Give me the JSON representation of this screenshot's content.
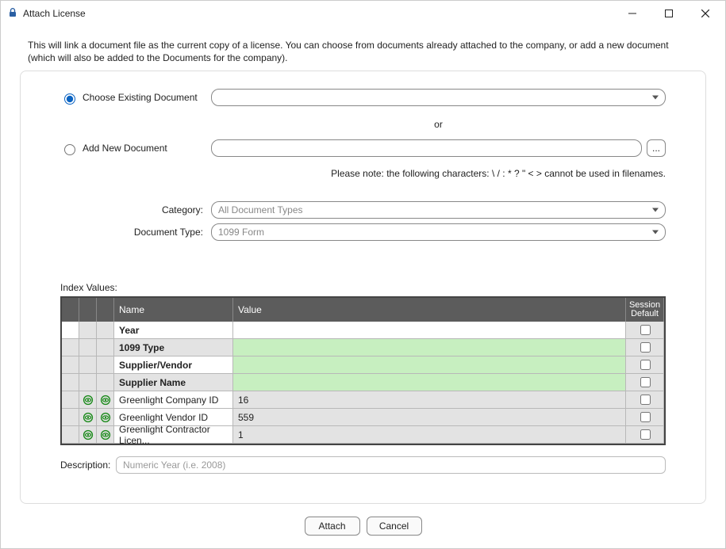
{
  "window": {
    "title": "Attach License"
  },
  "intro": "This will link a document file as the current copy of a license.  You can choose from documents already attached to the company, or add a new document (which will also be added to the Documents for the  company).",
  "radios": {
    "existing": "Choose Existing Document",
    "addnew": "Add New Document"
  },
  "or": "or",
  "ellipsis": "...",
  "note": "Please note:  the following characters:  \\ / : * ? \" < > cannot be used in filenames.",
  "form": {
    "category_label": "Category:",
    "category_value": "All Document Types",
    "doctype_label": "Document Type:",
    "doctype_value": "1099 Form"
  },
  "index_section": "Index Values:",
  "grid": {
    "head": {
      "name": "Name",
      "value": "Value",
      "session": "Session Default"
    },
    "rows": [
      {
        "bold": true,
        "a_white": true,
        "name": "Year",
        "value": "",
        "val_bg": "white"
      },
      {
        "bold": true,
        "name": "1099 Type",
        "name_bg": "grey",
        "value": "",
        "val_bg": "green"
      },
      {
        "bold": true,
        "name": "Supplier/Vendor",
        "value": "",
        "val_bg": "green"
      },
      {
        "bold": true,
        "name": "Supplier Name",
        "name_bg": "grey",
        "value": "",
        "val_bg": "green"
      },
      {
        "eye": true,
        "name": "Greenlight Company ID",
        "value": "16",
        "val_bg": "grey"
      },
      {
        "eye": true,
        "name": "Greenlight Vendor ID",
        "value": "559",
        "val_bg": "grey"
      },
      {
        "eye": true,
        "name": "Greenlight Contractor Licen...",
        "value": "1",
        "val_bg": "grey"
      }
    ]
  },
  "description": {
    "label": "Description:",
    "placeholder": "Numeric Year (i.e. 2008)"
  },
  "footer": {
    "attach": "Attach",
    "cancel": "Cancel"
  }
}
